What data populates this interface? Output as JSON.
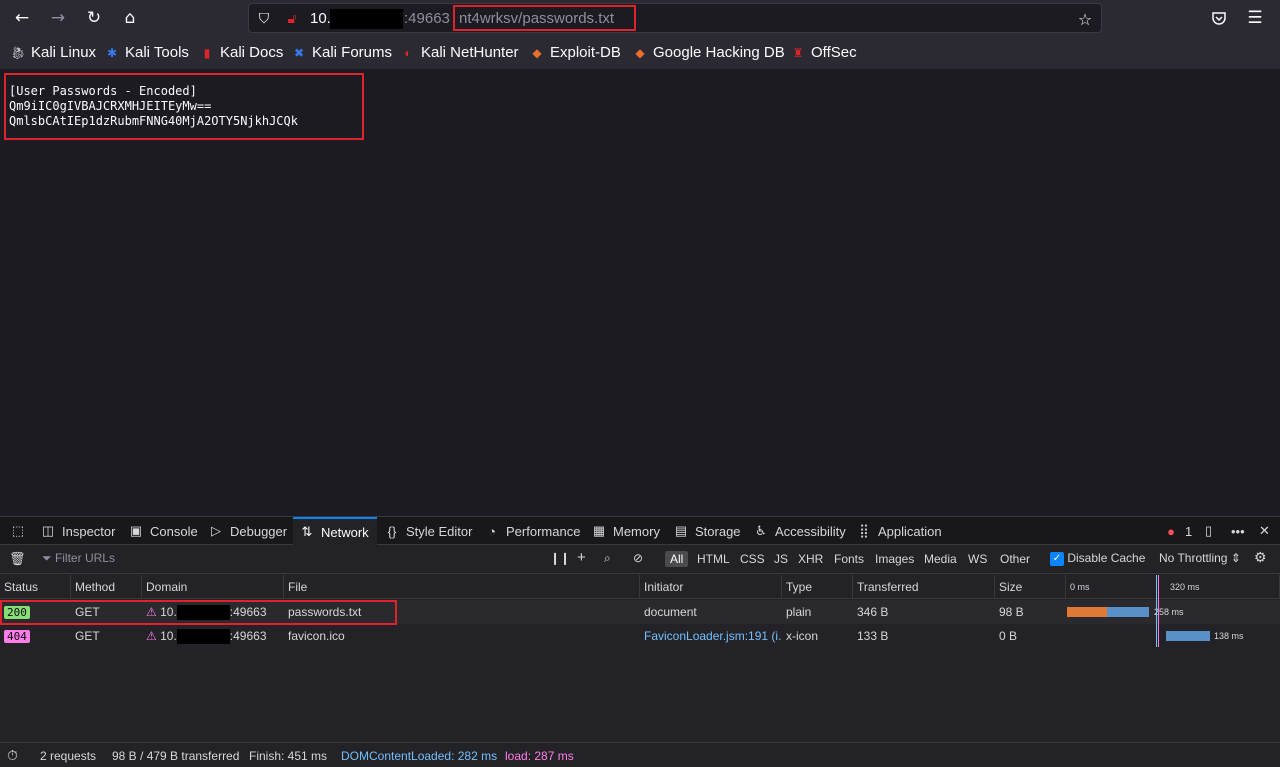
{
  "browser": {
    "url": {
      "host": "10.",
      "port": ":49663",
      "path": "nt4wrksv/passwords.txt"
    },
    "bookmarks": [
      {
        "label": "Kali Linux",
        "icon": "kali-dragon-icon"
      },
      {
        "label": "Kali Tools",
        "icon": "kali-tools-icon"
      },
      {
        "label": "Kali Docs",
        "icon": "kali-docs-icon"
      },
      {
        "label": "Kali Forums",
        "icon": "kali-forums-icon"
      },
      {
        "label": "Kali NetHunter",
        "icon": "nethunter-icon"
      },
      {
        "label": "Exploit-DB",
        "icon": "exploit-db-icon"
      },
      {
        "label": "Google Hacking DB",
        "icon": "ghdb-icon"
      },
      {
        "label": "OffSec",
        "icon": "offsec-icon"
      }
    ]
  },
  "page": {
    "lines": [
      "[User Passwords - Encoded]",
      "Qm9iIC0gIVBAJCRXMHJEITEyMw==",
      "QmlsbCAtIEp1dzRubmFNNG40MjA2OTY5NjkhJCQk"
    ]
  },
  "devtools": {
    "tabs": [
      {
        "label": "Inspector",
        "icon": "inspector-icon"
      },
      {
        "label": "Console",
        "icon": "console-icon"
      },
      {
        "label": "Debugger",
        "icon": "debugger-icon"
      },
      {
        "label": "Network",
        "icon": "network-icon"
      },
      {
        "label": "Style Editor",
        "icon": "style-editor-icon"
      },
      {
        "label": "Performance",
        "icon": "performance-icon"
      },
      {
        "label": "Memory",
        "icon": "memory-icon"
      },
      {
        "label": "Storage",
        "icon": "storage-icon"
      },
      {
        "label": "Accessibility",
        "icon": "accessibility-icon"
      },
      {
        "label": "Application",
        "icon": "application-icon"
      }
    ],
    "active_tab": "Network",
    "error_count": "1",
    "filter_placeholder": "Filter URLs",
    "type_filters": [
      "All",
      "HTML",
      "CSS",
      "JS",
      "XHR",
      "Fonts",
      "Images",
      "Media",
      "WS",
      "Other"
    ],
    "disable_cache_label": "Disable Cache",
    "throttling_label": "No Throttling",
    "columns": [
      "Status",
      "Method",
      "Domain",
      "File",
      "Initiator",
      "Type",
      "Transferred",
      "Size"
    ],
    "waterfall_ticks": [
      "0 ms",
      "320 ms"
    ],
    "requests": [
      {
        "status": "200",
        "method": "GET",
        "domain_prefix": "10.",
        "domain_port": ":49663",
        "file": "passwords.txt",
        "initiator": "document",
        "type": "plain",
        "transferred": "346 B",
        "size": "98 B",
        "timing": "258 ms"
      },
      {
        "status": "404",
        "method": "GET",
        "domain_prefix": "10.",
        "domain_port": ":49663",
        "file": "favicon.ico",
        "initiator": "FaviconLoader.jsm:191 (i...",
        "type": "x-icon",
        "transferred": "133 B",
        "size": "0 B",
        "timing": "138 ms"
      }
    ],
    "summary": {
      "requests": "2 requests",
      "transferred": "98 B / 479 B transferred",
      "finish": "Finish: 451 ms",
      "dom_content_loaded": "DOMContentLoaded: 282 ms",
      "load": "load: 287 ms"
    }
  },
  "colors": {
    "highlight": "#e0222b",
    "status_200": "#86de74",
    "status_404": "#ff7de9",
    "accent": "#0a84ff"
  }
}
